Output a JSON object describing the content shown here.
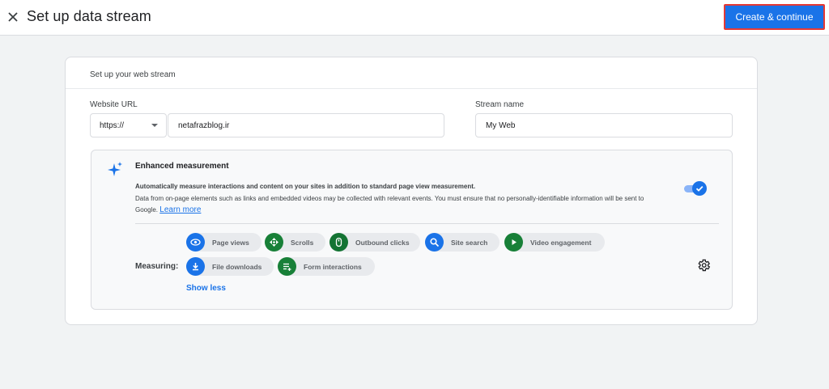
{
  "header": {
    "title": "Set up data stream",
    "create_button": "Create & continue"
  },
  "card": {
    "title": "Set up your web stream",
    "website_url_label": "Website URL",
    "protocol_value": "https://",
    "url_value": "netafrazblog.ir",
    "stream_name_label": "Stream name",
    "stream_name_value": "My Web"
  },
  "enhanced": {
    "title": "Enhanced measurement",
    "desc_bold": "Automatically measure interactions and content on your sites in addition to standard page view measurement.",
    "desc": "Data from on-page elements such as links and embedded videos may be collected with relevant events. You must ensure that no personally-identifiable information will be sent to Google.",
    "learn_more": "Learn more",
    "toggle_on": true,
    "measuring_label": "Measuring:",
    "chips": [
      {
        "label": "Page views",
        "icon": "eye-icon"
      },
      {
        "label": "Scrolls",
        "icon": "scroll-icon"
      },
      {
        "label": "Outbound clicks",
        "icon": "mouse-icon"
      },
      {
        "label": "Site search",
        "icon": "search-icon"
      },
      {
        "label": "Video engagement",
        "icon": "play-icon"
      },
      {
        "label": "File downloads",
        "icon": "download-icon"
      },
      {
        "label": "Form interactions",
        "icon": "form-icon"
      }
    ],
    "show_less": "Show less"
  },
  "colors": {
    "primary": "#1a73e8",
    "green": "#188038",
    "highlight_border": "#e53935"
  }
}
